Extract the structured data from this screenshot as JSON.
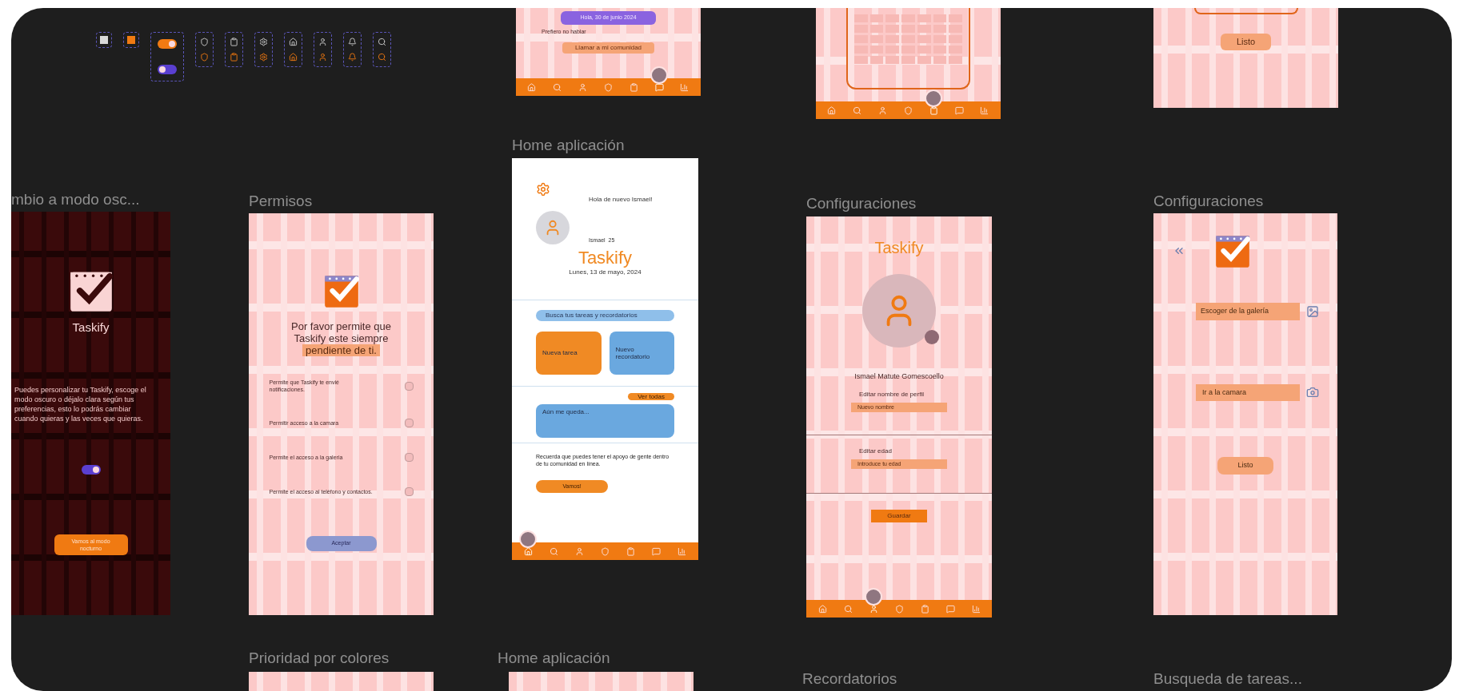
{
  "component_set": {
    "checkbox_variants": [
      {
        "checked": false
      },
      {
        "checked": true
      }
    ],
    "toggle_variants": [
      {
        "on": true
      },
      {
        "on": false
      }
    ]
  },
  "top_frames": [
    {
      "kind": "chat",
      "date": "Hola, 30 de junio 2024",
      "message": "Prefiero no hablar",
      "button": "Llamar a mi comunidad",
      "nav": [
        {
          "selected": false
        },
        {
          "selected": false
        },
        {
          "selected": false
        },
        {
          "selected": false
        },
        {
          "selected": false
        },
        {
          "selected": true
        },
        {
          "selected": false
        }
      ]
    },
    {
      "kind": "calendar",
      "nav": [
        {
          "selected": false
        },
        {
          "selected": false
        },
        {
          "selected": false
        },
        {
          "selected": false
        },
        {
          "selected": true
        },
        {
          "selected": false
        },
        {
          "selected": false
        }
      ]
    },
    {
      "kind": "done",
      "button": "Listo"
    }
  ],
  "dark_mode": {
    "title": "mbio a modo osc...",
    "app_name": "Taskify",
    "text": "Puedes personalizar tu Taskify, escoge el modo oscuro o déjalo clara según tus preferencias, esto lo podrás cambiar cuando quieras y las veces que quieras.",
    "toggle_on": true,
    "button": "Vamos al modo nocturno"
  },
  "permissions": {
    "title": "Permisos",
    "heading": "Por favor permite que Taskify este siempre",
    "highlight": "pendiente de ti.",
    "items": [
      {
        "label": "Permite que Taskify te envié notificaciones.",
        "checked": false
      },
      {
        "label": "Permitir acceso a la camara",
        "checked": false
      },
      {
        "label": "Permite el acceso a la galeria",
        "checked": false
      },
      {
        "label": "Permite el acceso al teléfono y contactos.",
        "checked": false
      }
    ],
    "button": "Aceptar"
  },
  "home": {
    "title": "Home aplicación",
    "greeting": "Hola de nuevo Ismael!",
    "user": "Ismael  25",
    "app_name": "Taskify",
    "date": "Lunes, 13 de mayo, 2024",
    "search_placeholder": "Busca tus tareas y recordatorios",
    "cards": [
      {
        "label": "Nueva tarea",
        "color": "#f08a24"
      },
      {
        "label": "Nuevo recordatorio",
        "color": "#6aa8df"
      }
    ],
    "see_all": "Ver todas",
    "note": "Aún me queda...",
    "support_text": "Recuerda que puedes tener el apoyo de gente dentro de tu comunidad en línea.",
    "support_button": "Vamos!",
    "nav": [
      {
        "selected": true
      },
      {
        "selected": false
      },
      {
        "selected": false
      },
      {
        "selected": false
      },
      {
        "selected": false
      },
      {
        "selected": false
      },
      {
        "selected": false
      }
    ]
  },
  "profile_settings": {
    "title": "Configuraciones",
    "app_name": "Taskify",
    "name": "Ismael Matute Gomescoello",
    "name_label": "Editar nombre de perfil",
    "name_placeholder": "Nuevo nombre",
    "age_label": "Editar edad",
    "age_placeholder": "Introduce tu edad",
    "button": "Guardar",
    "nav": [
      {
        "selected": false
      },
      {
        "selected": false
      },
      {
        "selected": true
      },
      {
        "selected": false
      },
      {
        "selected": false
      },
      {
        "selected": false
      },
      {
        "selected": false
      }
    ]
  },
  "photo_settings": {
    "title": "Configuraciones",
    "gallery_button": "Escoger de la galería",
    "camera_button": "Ir a la camara",
    "done_button": "Listo"
  },
  "bottom_frames": [
    {
      "title": "Prioridad por colores",
      "kind": "grid"
    },
    {
      "title": "Home aplicación",
      "kind": "grid"
    },
    {
      "title": "Recordatorios",
      "kind": "label"
    },
    {
      "title": "Busqueda de tareas...",
      "kind": "label"
    }
  ]
}
